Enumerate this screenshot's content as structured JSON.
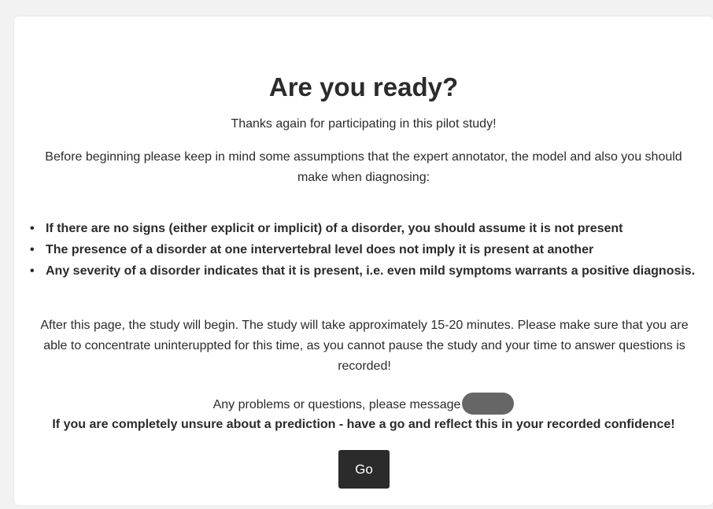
{
  "page": {
    "title": "Are you ready?",
    "thanks_text": "Thanks again for participating in this pilot study!",
    "intro_text": "Before beginning please keep in mind some assumptions that the expert annotator, the model and also you should make when diagnosing:",
    "bullet_symbol": "•",
    "assumptions": [
      "If there are no signs (either explicit or implicit) of a disorder, you should assume it is not present",
      "The presence of a disorder at one intervertebral level does not imply it is present at another",
      "Any severity of a disorder indicates that it is present, i.e. even mild symptoms warrants a positive diagnosis."
    ],
    "study_info_text": "After this page, the study will begin. The study will take approximately 15-20 minutes. Please make sure that you are able to concentrate uninteruppted for this time, as you cannot pause the study and your time to answer questions is recorded!",
    "contact_text": "Any problems or questions, please message",
    "unsure_text": "If you are completely unsure about a prediction - have a go and reflect this in your recorded confidence!",
    "go_label": "Go"
  },
  "colors": {
    "background": "#f2f2f2",
    "card": "#ffffff",
    "text": "#2b2b2b",
    "button_bg": "#2b2b2b",
    "button_text": "#ffffff",
    "redacted_pill": "#666666"
  }
}
